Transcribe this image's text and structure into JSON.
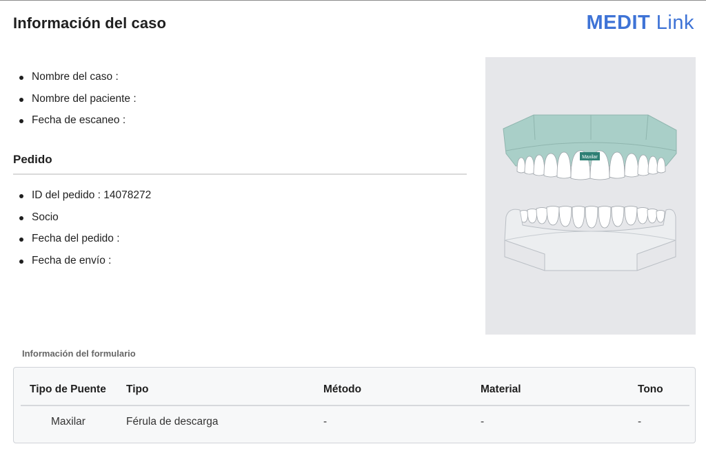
{
  "header": {
    "title": "Información del caso",
    "brand_main": "MEDIT",
    "brand_suffix": "Link",
    "brand_color": "#3e73d6"
  },
  "case_info": [
    {
      "label": "Nombre del caso :"
    },
    {
      "label": "Nombre del paciente :"
    },
    {
      "label": "Fecha de escaneo :"
    }
  ],
  "order": {
    "title": "Pedido",
    "items": [
      {
        "label": "ID del pedido : 14078272"
      },
      {
        "label": "Socio"
      },
      {
        "label": "Fecha del pedido :"
      },
      {
        "label": "Fecha de envío :"
      }
    ]
  },
  "preview": {
    "upper_label": "Maxilar",
    "upper_tint": "#a9cfc8",
    "label_bg": "#2e7f74"
  },
  "form": {
    "title": "Información del formulario",
    "columns": [
      "Tipo de Puente",
      "Tipo",
      "Método",
      "Material",
      "Tono"
    ],
    "rows": [
      [
        "Maxilar",
        "Férula de descarga",
        "-",
        "-",
        "-"
      ]
    ]
  }
}
